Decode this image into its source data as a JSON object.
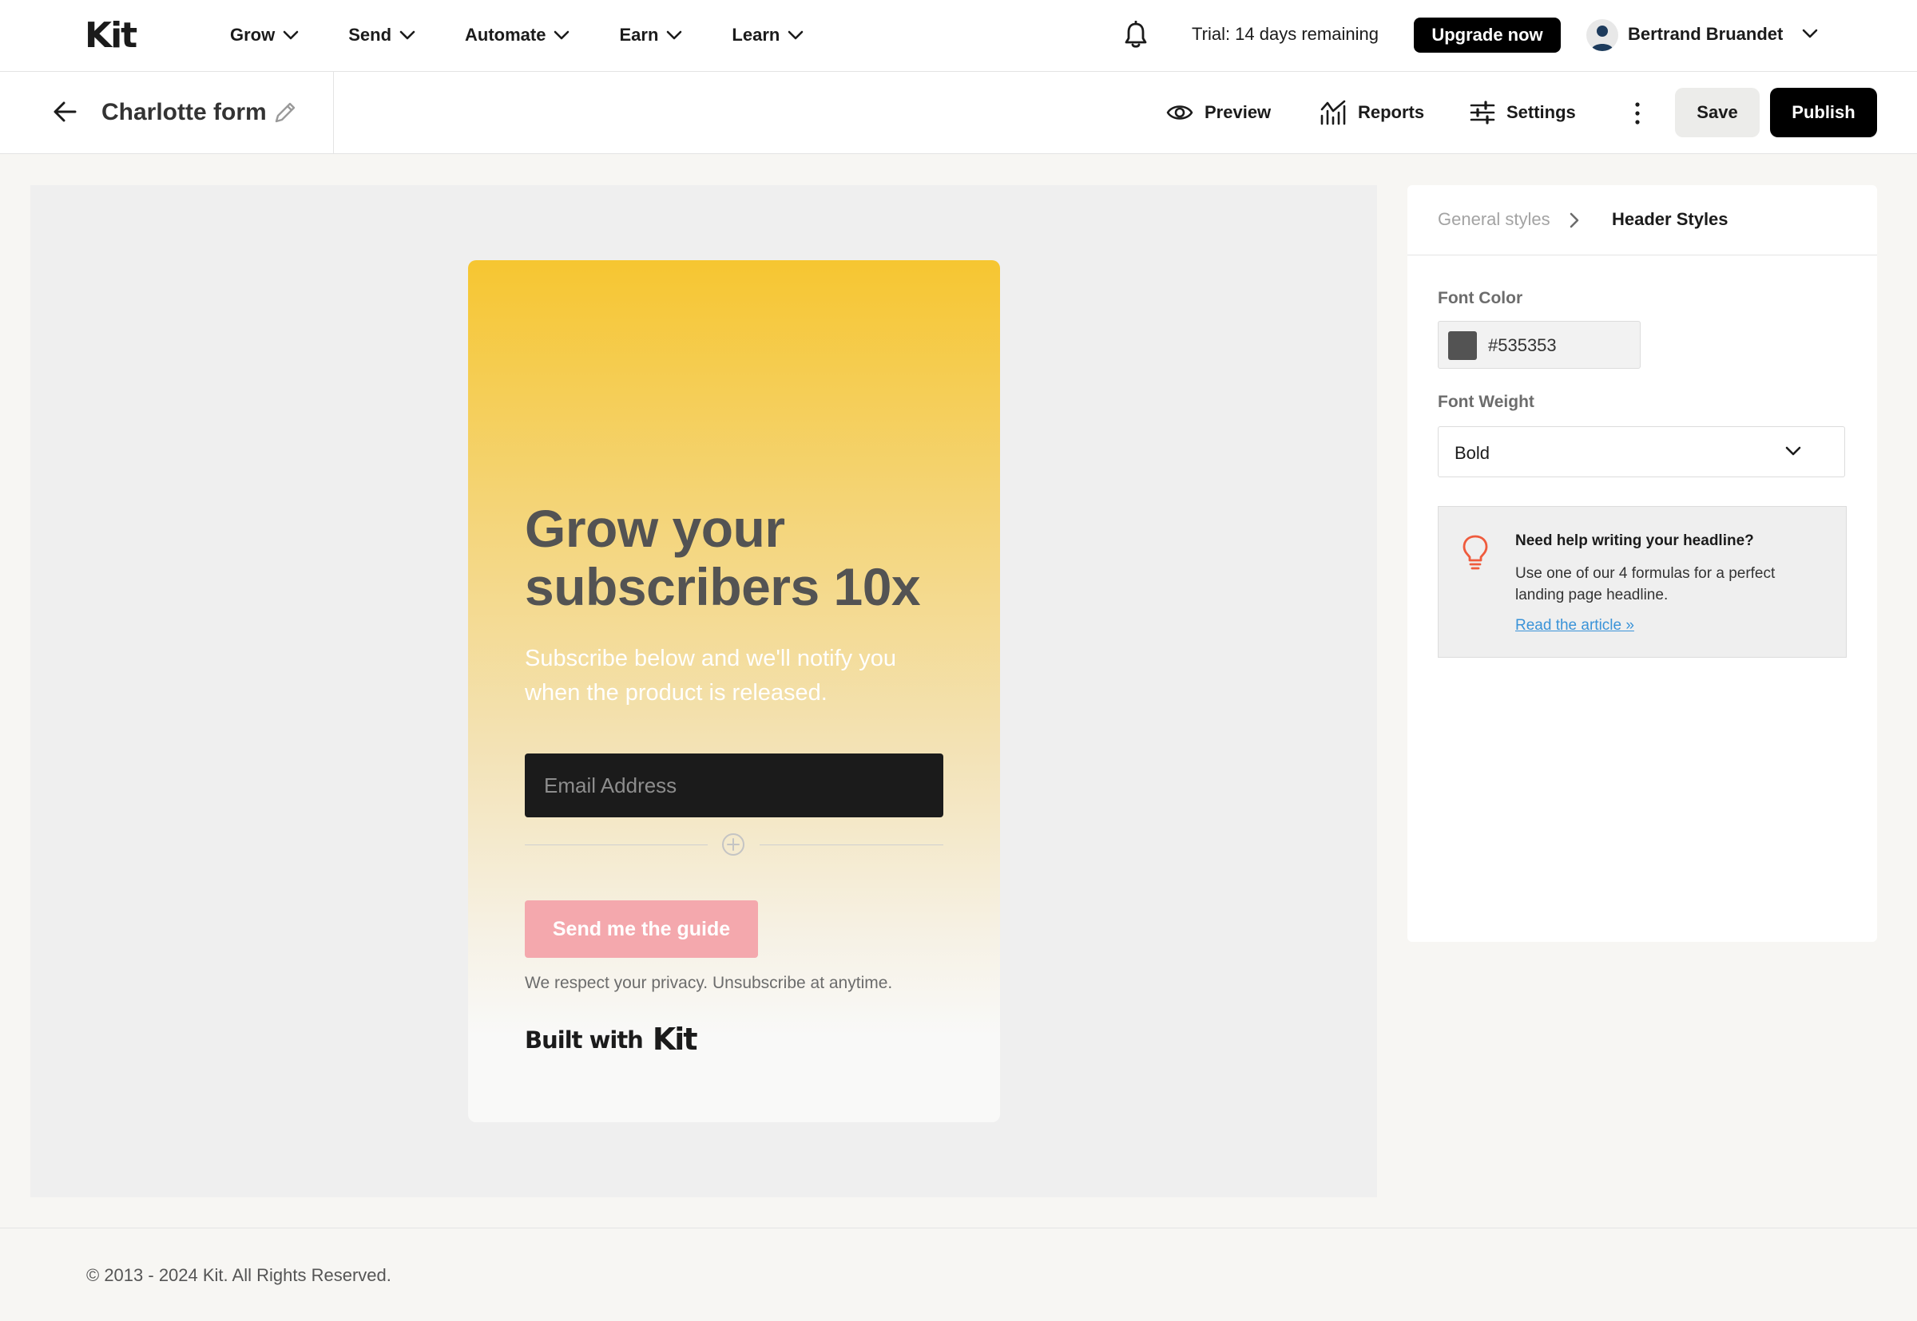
{
  "brand": {
    "logo_text": "Kit"
  },
  "nav": {
    "items": [
      {
        "label": "Grow"
      },
      {
        "label": "Send"
      },
      {
        "label": "Automate"
      },
      {
        "label": "Earn"
      },
      {
        "label": "Learn"
      }
    ],
    "trial_text": "Trial: 14 days remaining",
    "upgrade_label": "Upgrade now",
    "user_name": "Bertrand Bruandet"
  },
  "toolbar": {
    "form_title": "Charlotte form",
    "preview_label": "Preview",
    "reports_label": "Reports",
    "settings_label": "Settings",
    "save_label": "Save",
    "publish_label": "Publish"
  },
  "form": {
    "headline": "Grow your subscribers 10x",
    "subtext": "Subscribe below and we'll notify you when the product is released.",
    "email_placeholder": "Email Address",
    "submit_label": "Send me the guide",
    "privacy_text": "We respect your privacy. Unsubscribe at anytime.",
    "built_with_text": "Built with",
    "built_with_logo": "Kit",
    "colors": {
      "gradient_top": "#f6c631",
      "headline": "#535353",
      "button": "#f4a8ad",
      "input": "#1b1b1b"
    }
  },
  "panel": {
    "breadcrumb_parent": "General styles",
    "breadcrumb_current": "Header Styles",
    "font_color_label": "Font Color",
    "font_color_value": "#535353",
    "font_weight_label": "Font Weight",
    "font_weight_value": "Bold",
    "tip": {
      "title": "Need help writing your headline?",
      "body": "Use one of our 4 formulas for a perfect landing page headline.",
      "link": "Read the article »",
      "icon_color": "#ef5b3d"
    }
  },
  "footer": {
    "copyright": "© 2013 - 2024 Kit. All Rights Reserved."
  }
}
